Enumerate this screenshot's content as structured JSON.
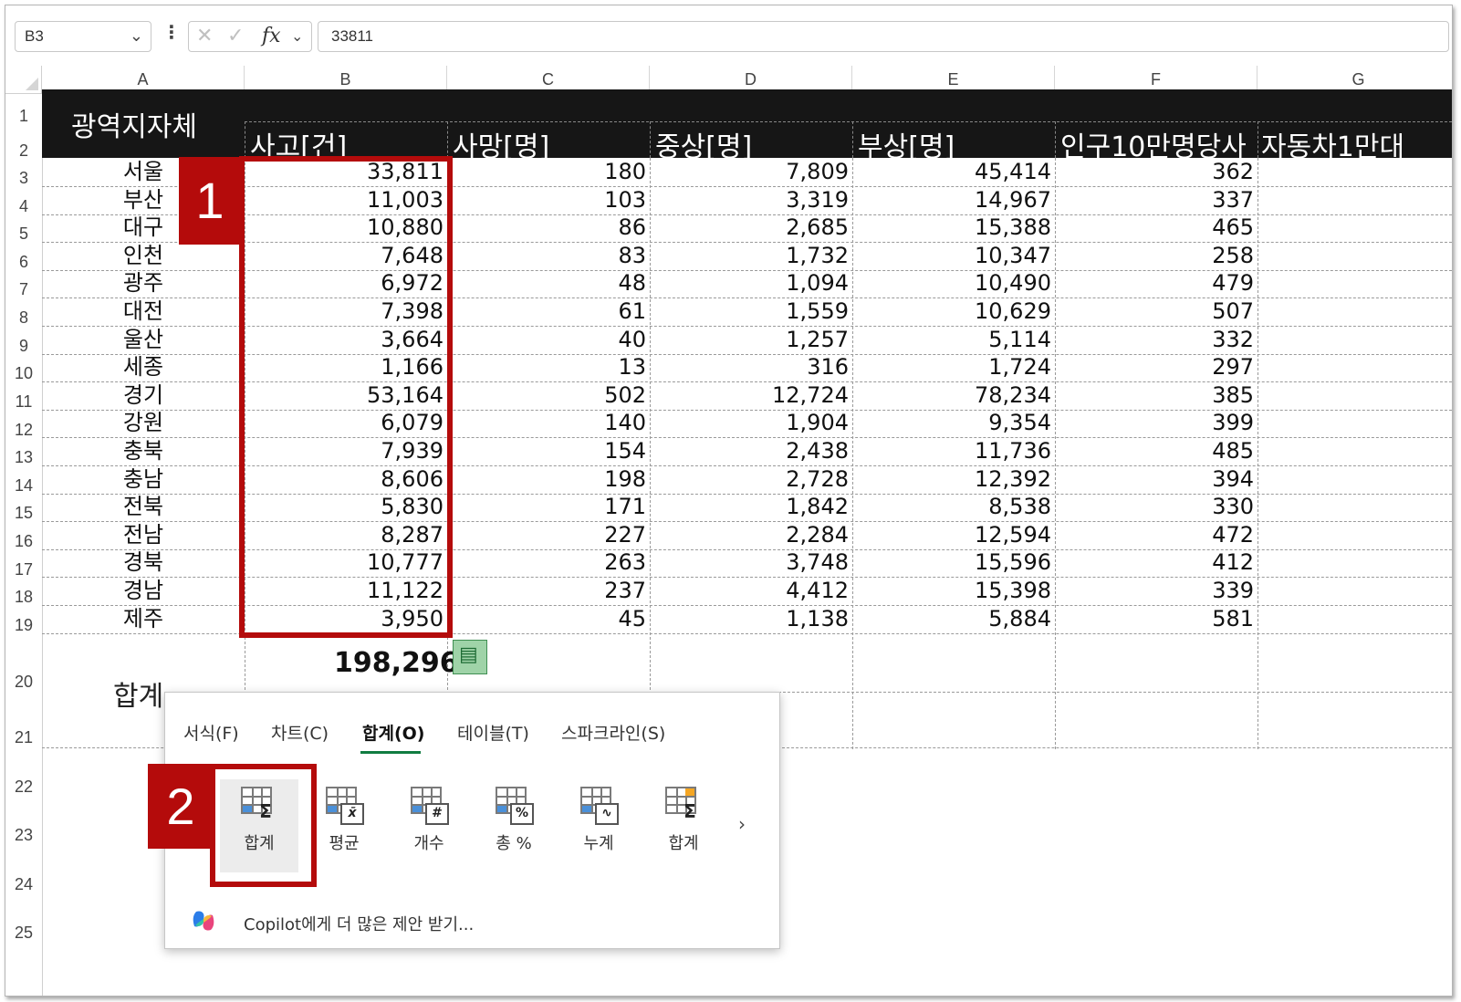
{
  "formula_bar": {
    "name_box": "B3",
    "fx_label": "fx",
    "formula_value": "33811"
  },
  "columns": [
    "A",
    "B",
    "C",
    "D",
    "E",
    "F",
    "G"
  ],
  "rows": [
    "1",
    "2",
    "3",
    "4",
    "5",
    "6",
    "7",
    "8",
    "9",
    "10",
    "11",
    "12",
    "13",
    "14",
    "15",
    "16",
    "17",
    "18",
    "19",
    "20",
    "21",
    "22",
    "23",
    "24",
    "25"
  ],
  "headers": {
    "a": "광역지자체",
    "b": "사고[건]",
    "c": "사망[명]",
    "d": "중상[명]",
    "e": "부상[명]",
    "f": "인구10만명당사",
    "g": "자동차1만대"
  },
  "table": [
    {
      "name": "서울",
      "b": "33,811",
      "c": "180",
      "d": "7,809",
      "e": "45,414",
      "f": "362"
    },
    {
      "name": "부산",
      "b": "11,003",
      "c": "103",
      "d": "3,319",
      "e": "14,967",
      "f": "337"
    },
    {
      "name": "대구",
      "b": "10,880",
      "c": "86",
      "d": "2,685",
      "e": "15,388",
      "f": "465"
    },
    {
      "name": "인천",
      "b": "7,648",
      "c": "83",
      "d": "1,732",
      "e": "10,347",
      "f": "258"
    },
    {
      "name": "광주",
      "b": "6,972",
      "c": "48",
      "d": "1,094",
      "e": "10,490",
      "f": "479"
    },
    {
      "name": "대전",
      "b": "7,398",
      "c": "61",
      "d": "1,559",
      "e": "10,629",
      "f": "507"
    },
    {
      "name": "울산",
      "b": "3,664",
      "c": "40",
      "d": "1,257",
      "e": "5,114",
      "f": "332"
    },
    {
      "name": "세종",
      "b": "1,166",
      "c": "13",
      "d": "316",
      "e": "1,724",
      "f": "297"
    },
    {
      "name": "경기",
      "b": "53,164",
      "c": "502",
      "d": "12,724",
      "e": "78,234",
      "f": "385"
    },
    {
      "name": "강원",
      "b": "6,079",
      "c": "140",
      "d": "1,904",
      "e": "9,354",
      "f": "399"
    },
    {
      "name": "충북",
      "b": "7,939",
      "c": "154",
      "d": "2,438",
      "e": "11,736",
      "f": "485"
    },
    {
      "name": "충남",
      "b": "8,606",
      "c": "198",
      "d": "2,728",
      "e": "12,392",
      "f": "394"
    },
    {
      "name": "전북",
      "b": "5,830",
      "c": "171",
      "d": "1,842",
      "e": "8,538",
      "f": "330"
    },
    {
      "name": "전남",
      "b": "8,287",
      "c": "227",
      "d": "2,284",
      "e": "12,594",
      "f": "472"
    },
    {
      "name": "경북",
      "b": "10,777",
      "c": "263",
      "d": "3,748",
      "e": "15,596",
      "f": "412"
    },
    {
      "name": "경남",
      "b": "11,122",
      "c": "237",
      "d": "4,412",
      "e": "15,398",
      "f": "339"
    },
    {
      "name": "제주",
      "b": "3,950",
      "c": "45",
      "d": "1,138",
      "e": "5,884",
      "f": "581"
    }
  ],
  "total": {
    "label": "합계",
    "value": "198,296"
  },
  "badges": {
    "one": "1",
    "two": "2"
  },
  "quick_analysis": {
    "tabs": [
      "서식(F)",
      "차트(C)",
      "합계(O)",
      "테이블(T)",
      "스파크라인(S)"
    ],
    "active_tab": "합계(O)",
    "items": [
      {
        "label": "합계",
        "icon": "sum-icon"
      },
      {
        "label": "평균",
        "icon": "average-icon"
      },
      {
        "label": "개수",
        "icon": "count-icon"
      },
      {
        "label": "총 %",
        "icon": "percent-total-icon"
      },
      {
        "label": "누계",
        "icon": "running-total-icon"
      },
      {
        "label": "합계",
        "icon": "sum-column-icon"
      }
    ],
    "more": "›",
    "copilot_text": "Copilot에게 더 많은 제안 받기..."
  },
  "colors": {
    "header_band": "#161616",
    "highlight_red": "#b40b0b",
    "excel_green": "#107c41"
  }
}
